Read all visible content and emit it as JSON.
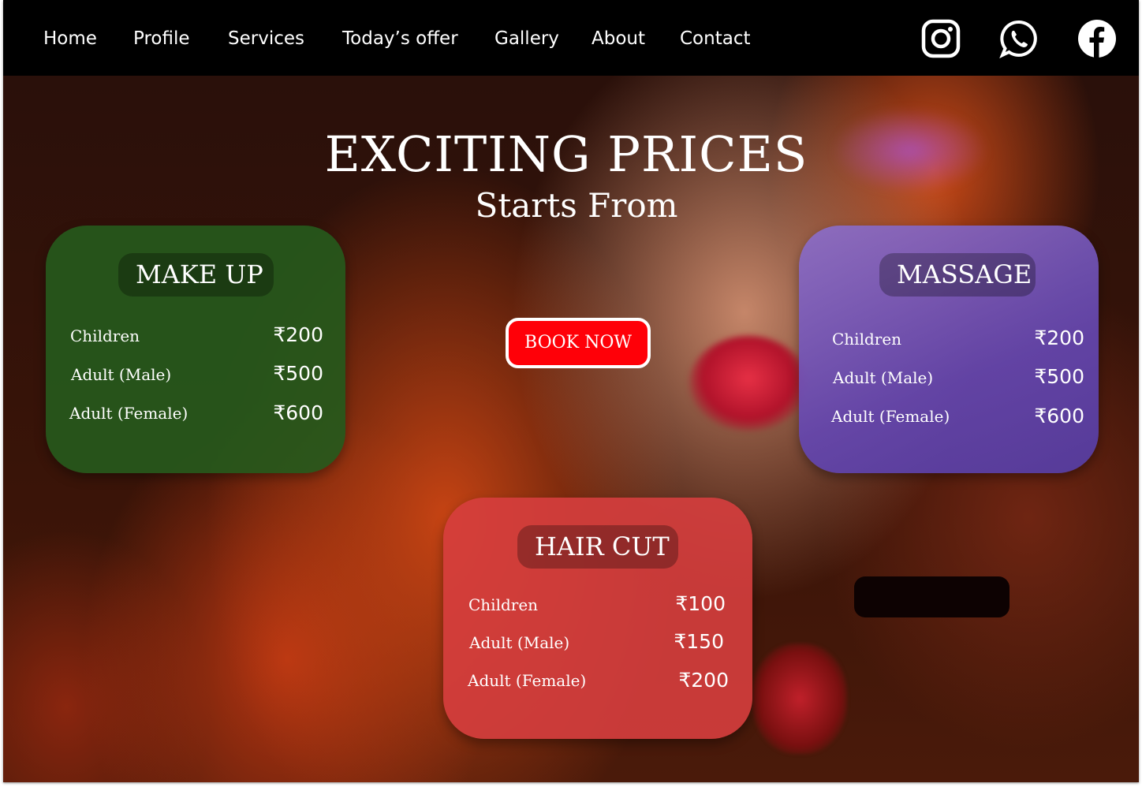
{
  "nav": {
    "items": [
      {
        "label": "Home"
      },
      {
        "label": "Profile"
      },
      {
        "label": "Services"
      },
      {
        "label": "Today’s offer"
      },
      {
        "label": "Gallery"
      },
      {
        "label": "About"
      },
      {
        "label": "Contact"
      }
    ],
    "social_icons": [
      "instagram-icon",
      "whatsapp-icon",
      "facebook-icon"
    ]
  },
  "hero": {
    "title": "EXCITING PRICES",
    "subtitle": "Starts From",
    "book_button": "BOOK NOW"
  },
  "cards": [
    {
      "title": "MAKE UP",
      "color": "#26581c",
      "rows": [
        {
          "label": "Children",
          "price": "₹200"
        },
        {
          "label": "Adult (Male)",
          "price": "₹500"
        },
        {
          "label": "Adult (Female)",
          "price": "₹600"
        }
      ]
    },
    {
      "title": "MASSAGE",
      "color": "#7a5fc0",
      "rows": [
        {
          "label": "Children",
          "price": "₹200"
        },
        {
          "label": "Adult (Male)",
          "price": "₹500"
        },
        {
          "label": "Adult (Female)",
          "price": "₹600"
        }
      ]
    },
    {
      "title": "HAIR CUT",
      "color": "#d63e3e",
      "rows": [
        {
          "label": "Children",
          "price": "₹100"
        },
        {
          "label": "Adult (Male)",
          "price": "₹150"
        },
        {
          "label": "Adult (Female)",
          "price": "₹200"
        }
      ]
    }
  ],
  "colors": {
    "nav_bg": "#000000",
    "button_bg": "#ff0008",
    "text": "#ffffff"
  }
}
